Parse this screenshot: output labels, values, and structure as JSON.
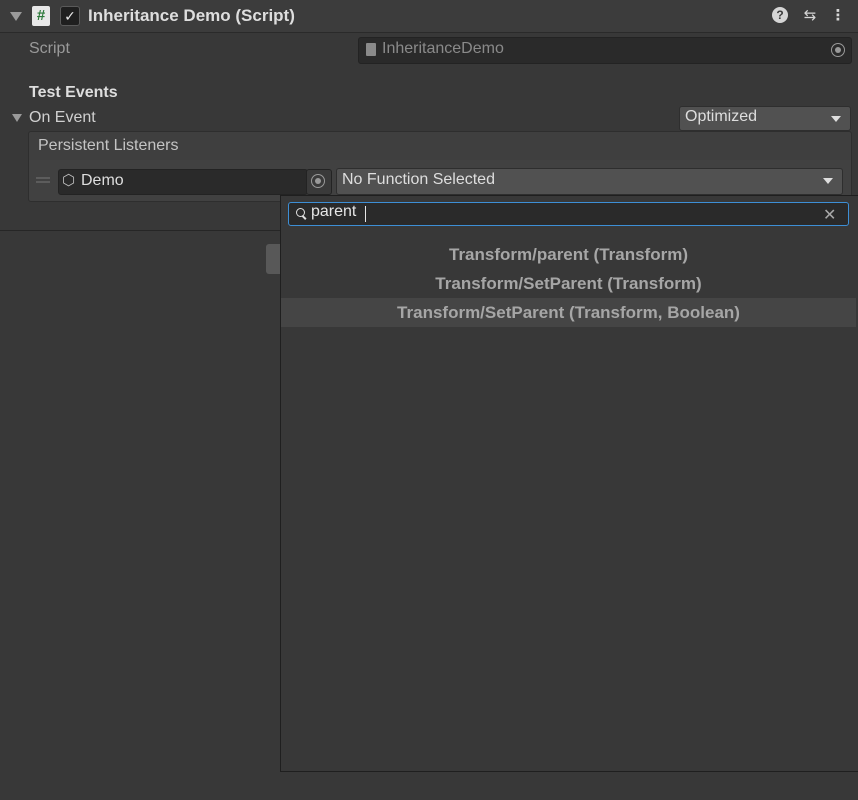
{
  "header": {
    "title": "Inheritance Demo (Script)",
    "hash_glyph": "#",
    "check_glyph": "✓",
    "help_glyph": "?",
    "settings_glyph": "⇆",
    "more_glyph": "⋮"
  },
  "script_row": {
    "label": "Script",
    "value": "InheritanceDemo"
  },
  "section": {
    "title": "Test Events",
    "event_name": "On Event",
    "mode": "Optimized"
  },
  "listeners": {
    "header": "Persistent Listeners",
    "object": "Demo",
    "object_icon_glyph": "⬡",
    "function": "No Function Selected"
  },
  "popup": {
    "search_value": "parent",
    "clear_glyph": "✕",
    "results": [
      "Transform/parent (Transform)",
      "Transform/SetParent (Transform)",
      "Transform/SetParent (Transform, Boolean)"
    ],
    "highlighted_index": 2
  },
  "colors": {
    "background": "#383838",
    "highlight": "#454545",
    "focus_border": "#3d8fd6"
  }
}
